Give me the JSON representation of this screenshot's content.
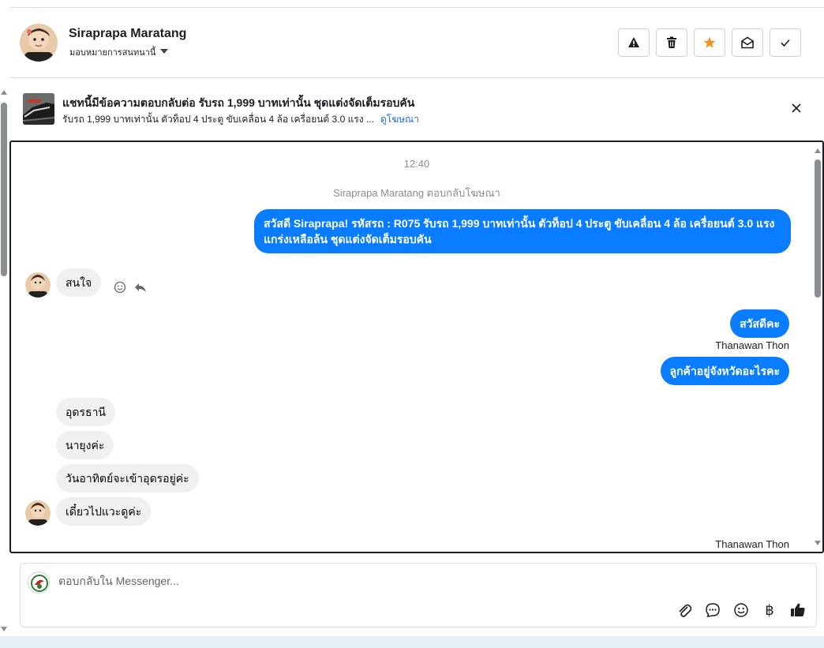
{
  "header": {
    "contact_name": "Siraprapa Maratang",
    "assign_label": "มอบหมายการสนทนานี้",
    "actions": [
      {
        "icon": "warning-icon",
        "color": "#1c1e21"
      },
      {
        "icon": "trash-icon",
        "color": "#1c1e21"
      },
      {
        "icon": "star-icon",
        "color": "#f0932b"
      },
      {
        "icon": "envelope-open-icon",
        "color": "#1c1e21"
      },
      {
        "icon": "check-icon",
        "color": "#1c1e21"
      }
    ]
  },
  "ad": {
    "title": "แชทนี้มีข้อความตอบกลับต่อ รับรถ 1,999 บาทเท่านั้น ชุดแต่งจัดเต็มรอบคัน",
    "subtitle": "รับรถ 1,999 บาทเท่านั้น ตัวท็อป 4 ประตู ขับเคลื่อน 4 ล้อ เครื่อยนต์ 3.0 แรง ...",
    "link": "ดูโฆษณา"
  },
  "chat": {
    "timestamp": "12:40",
    "system_note": "Siraprapa Maratang ตอบกลับโฆษณา",
    "outgoing_ad_reply": "สวัสดี Siraprapa! รหัสรถ : R075 รับรถ 1,999 บาทเท่านั้น ตัวท็อป 4 ประตู ขับเคลื่อน 4 ล้อ  เครื่อยนต์ 3.0 แรง แกร่งเหลือล้น ชุดแต่งจัดเต็มรอบคัน",
    "incoming_1": "สนใจ",
    "outgoing_1": "สวัสดีคะ",
    "sender_1": "Thanawan Thon",
    "outgoing_2": "ลูกค้าอยู่จังหวัดอะไรคะ",
    "incoming_2": "อุดรธานี",
    "incoming_3": "นายุงค่ะ",
    "incoming_4": "วันอาทิตย์จะเข้าอุดรอยู่ค่ะ",
    "incoming_5": "เดี๋ยวไปแวะดูค่ะ",
    "sender_2": "Thanawan Thon"
  },
  "composer": {
    "placeholder": "ตอบกลับใน Messenger...",
    "tools": [
      "paperclip-icon",
      "chat-bubble-icon",
      "emoji-icon",
      "baht-icon",
      "thumbs-up-icon"
    ],
    "baht_symbol": "฿"
  },
  "colors": {
    "outgoing_bubble": "#0a7cff",
    "incoming_bubble": "#f0f0f0",
    "link": "#216fdb",
    "star": "#f0932b"
  }
}
